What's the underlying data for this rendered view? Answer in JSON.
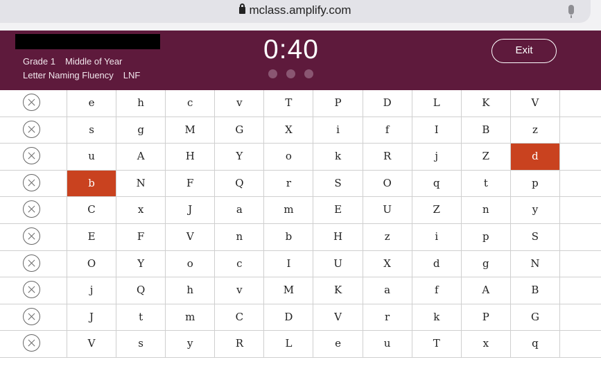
{
  "browser": {
    "url": "mclass.amplify.com"
  },
  "header": {
    "grade": "Grade 1",
    "period": "Middle of Year",
    "measure": "Letter Naming Fluency",
    "measure_code": "LNF",
    "timer": "0:40",
    "exit_label": "Exit",
    "colors": {
      "header_bg": "#5e1a3c",
      "marked_cell": "#c9421f"
    }
  },
  "grid": {
    "rows": [
      {
        "letters": [
          "e",
          "h",
          "c",
          "v",
          "T",
          "P",
          "D",
          "L",
          "K",
          "V"
        ]
      },
      {
        "letters": [
          "s",
          "g",
          "M",
          "G",
          "X",
          "i",
          "f",
          "I",
          "B",
          "z"
        ]
      },
      {
        "letters": [
          "u",
          "A",
          "H",
          "Y",
          "o",
          "k",
          "R",
          "j",
          "Z",
          "d"
        ]
      },
      {
        "letters": [
          "b",
          "N",
          "F",
          "Q",
          "r",
          "S",
          "O",
          "q",
          "t",
          "p"
        ]
      },
      {
        "letters": [
          "C",
          "x",
          "J",
          "a",
          "m",
          "E",
          "U",
          "Z",
          "n",
          "y"
        ]
      },
      {
        "letters": [
          "E",
          "F",
          "V",
          "n",
          "b",
          "H",
          "z",
          "i",
          "p",
          "S"
        ]
      },
      {
        "letters": [
          "O",
          "Y",
          "o",
          "c",
          "I",
          "U",
          "X",
          "d",
          "g",
          "N"
        ]
      },
      {
        "letters": [
          "j",
          "Q",
          "h",
          "v",
          "M",
          "K",
          "a",
          "f",
          "A",
          "B"
        ]
      },
      {
        "letters": [
          "J",
          "t",
          "m",
          "C",
          "D",
          "V",
          "r",
          "k",
          "P",
          "G"
        ]
      },
      {
        "letters": [
          "V",
          "s",
          "y",
          "R",
          "L",
          "e",
          "u",
          "T",
          "x",
          "q"
        ]
      }
    ],
    "marked": [
      {
        "row": 2,
        "col": 9
      },
      {
        "row": 3,
        "col": 0
      }
    ]
  }
}
